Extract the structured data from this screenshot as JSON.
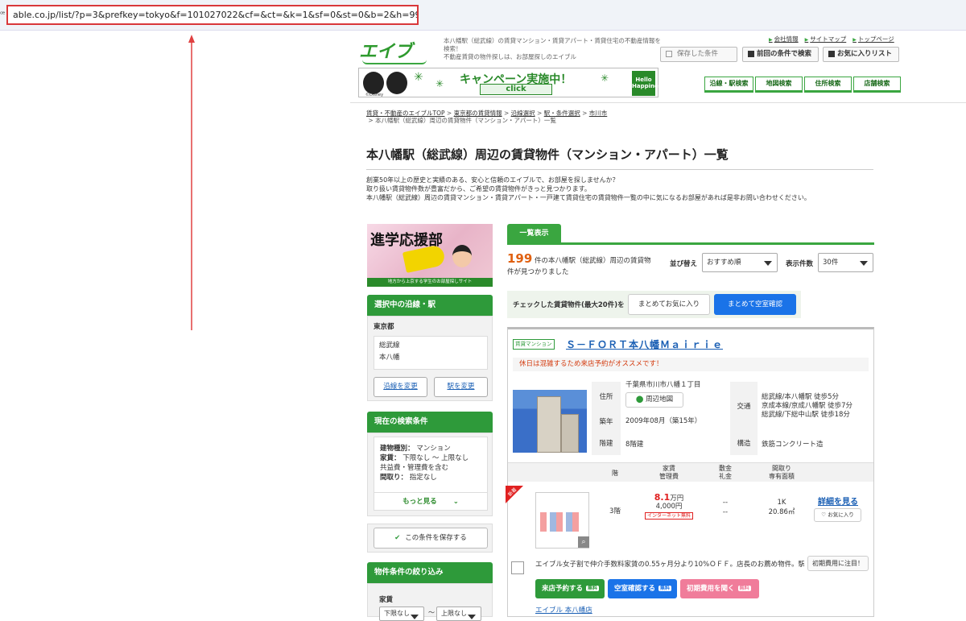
{
  "browser": {
    "url": "able.co.jp/list/?p=3&prefkey=tokyo&f=101027022&cf=&ct=&k=1&sf=0&st=0&b=2&h=99&j=&jks=0&n=B",
    "site_info_icon": "ꟹ"
  },
  "header": {
    "logo": "エイブル",
    "description": "本八幡駅（総武線）の賃貸マンション・賃貸アパート・賃貸住宅の不動産情報を検索！\n不動産賃貸の物件探しは、お部屋探しのエイブル",
    "top_links": [
      "会社情報",
      "サイトマップ",
      "トップページ"
    ],
    "saved_conditions": "保存した条件",
    "prev_conditions": "前回の条件で検索",
    "favorites": "お気に入りリスト",
    "nav_tabs": [
      "沿線・駅検索",
      "地図検索",
      "住所検索",
      "店舗検索"
    ],
    "banner": {
      "title": "キャンペーン実施中！",
      "click": "click",
      "hello": "Hello Happiness!",
      "disney": "©Disney"
    }
  },
  "breadcrumb": {
    "items": [
      "賃貸・不動産のエイブルTOP",
      "東京都の賃貸情報",
      "沿線選択",
      "駅・条件選択",
      "市川市"
    ],
    "current": "本八幡駅（総武線）周辺の賃貸物件（マンション・アパート）一覧"
  },
  "page_title": "本八幡駅（総武線）周辺の賃貸物件（マンション・アパート）一覧",
  "intro": [
    "創業50年以上の歴史と実績のある、安心と信頼のエイブルで、お部屋を探しませんか？",
    "取り扱い賃貸物件数が豊富だから、ご希望の賃貸物件がきっと見つかります。",
    "本八幡駅（総武線）周辺の賃貸マンション・賃貸アパート・一戸建て賃貸住宅の賃貸物件一覧の中に気になるお部屋があれば是非お問い合わせください。"
  ],
  "sidebar": {
    "promo_title": "進学応援部",
    "promo_sub": "地方から上京する学生のお部屋探しサイト",
    "selected_section": {
      "heading": "選択中の沿線・駅",
      "pref": "東京都",
      "line": "総武線",
      "station": "本八幡",
      "change_line": "沿線を変更",
      "change_station": "駅を変更"
    },
    "conditions_section": {
      "heading": "現在の検索条件",
      "rows": [
        {
          "label": "建物種別：",
          "value": "マンション"
        },
        {
          "label": "家賃：",
          "value": "下限なし ～ 上限なし"
        },
        {
          "label": "共益費・管理費を含む",
          "value": ""
        },
        {
          "label": "間取り：",
          "value": "指定なし"
        }
      ],
      "more": "もっと見る",
      "save": "この条件を保存する"
    },
    "filter_section": {
      "heading": "物件条件の絞り込み",
      "rent_label": "家賃",
      "min": "下限なし",
      "max": "上限なし",
      "tilde": "～"
    }
  },
  "results": {
    "tab": "一覧表示",
    "count": "199",
    "count_text": "件の本八幡駅（総武線）周辺の賃貸物件が見つかりました",
    "sort_label": "並び替え",
    "sort_value": "おすすめ順",
    "per_page_label": "表示件数",
    "per_page_value": "30件",
    "check_text": "チェックした賃貸物件(最大20件)を",
    "bulk_fav": "まとめてお気に入り",
    "bulk_vacancy": "まとめて空室確認"
  },
  "property": {
    "type_tag": "賃貸マンション",
    "name": "Ｓ－ＦＯＲＴ本八幡Ｍａｉｒｉｅ",
    "notice": "休日は混雑するため来店予約がオススメです！",
    "address_label": "住所",
    "address": "千葉県市川市八幡１丁目",
    "map_button": "周辺地図",
    "built_label": "築年",
    "built": "2009年08月（築15年）",
    "floors_label": "階建",
    "floors": "8階建",
    "traffic_label": "交通",
    "traffic": [
      "総武線/本八幡駅 徒歩5分",
      "京成本線/京成八幡駅 徒歩7分",
      "総武線/下総中山駅 徒歩18分"
    ],
    "structure_label": "構造",
    "structure": "鉄筋コンクリート造",
    "table_headers": {
      "floor": "階",
      "rent": "家賃\n管理費",
      "deposit": "敷金\n礼金",
      "layout": "間取り\n専有面積"
    },
    "room": {
      "new_tag": "新着",
      "floor": "3階",
      "rent": "8.1",
      "rent_unit": "万円",
      "mgmt_fee": "4,000円",
      "internet": "インターネット無料",
      "deposit": "--",
      "key_money": "--",
      "layout": "1K",
      "area": "20.86㎡",
      "detail": "詳細を見る",
      "fav": "お気に入り"
    },
    "comment": "エイブル女子割で仲介手数料家賃の0.55ヶ月分より10%ＯＦＦ。店長のお薦め物件。駅…",
    "initial_cost": "初期費用に注目！",
    "actions": [
      {
        "label": "来店予約する",
        "free": "無料"
      },
      {
        "label": "空室確認する",
        "free": "無料"
      },
      {
        "label": "初期費用を聞く",
        "free": "無料"
      }
    ],
    "store": "エイブル 本八幡店"
  }
}
